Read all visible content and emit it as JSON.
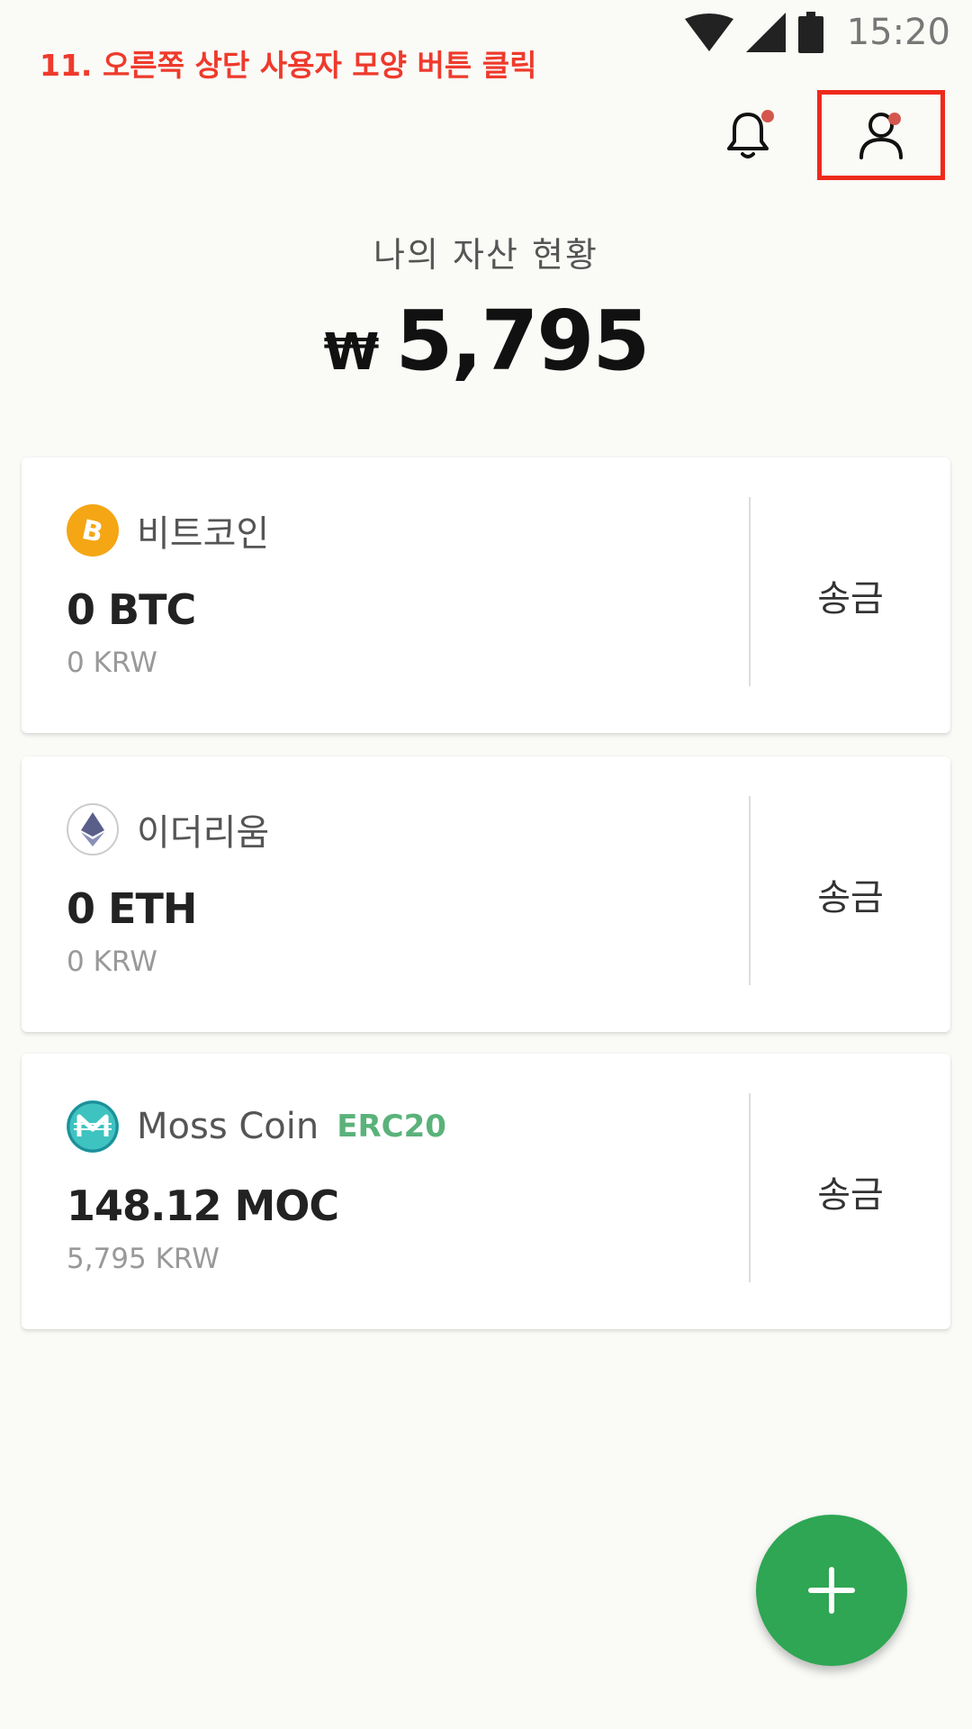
{
  "status_bar": {
    "time": "15:20",
    "icons": [
      "wifi-icon",
      "signal-icon",
      "battery-icon"
    ]
  },
  "instruction": "11. 오른쪽 상단 사용자 모양 버튼 클릭",
  "header": {
    "icons": [
      "bell-icon",
      "user-icon"
    ],
    "accent_dot_color": "#d4574d",
    "highlight_color": "#ee2a1c"
  },
  "summary": {
    "label": "나의 자산 현황",
    "currency_symbol": "₩",
    "amount": "5,795"
  },
  "assets": [
    {
      "name": "비트코인",
      "tag": "",
      "balance": "0 BTC",
      "krw": "0 KRW",
      "send_label": "송금",
      "icon": "bitcoin-icon"
    },
    {
      "name": "이더리움",
      "tag": "",
      "balance": "0 ETH",
      "krw": "0 KRW",
      "send_label": "송금",
      "icon": "ethereum-icon"
    },
    {
      "name": "Moss Coin",
      "tag": "ERC20",
      "balance": "148.12 MOC",
      "krw": "5,795 KRW",
      "send_label": "송금",
      "icon": "mosscoin-icon"
    }
  ],
  "fab": {
    "icon": "plus-icon",
    "color": "#2ea653"
  }
}
